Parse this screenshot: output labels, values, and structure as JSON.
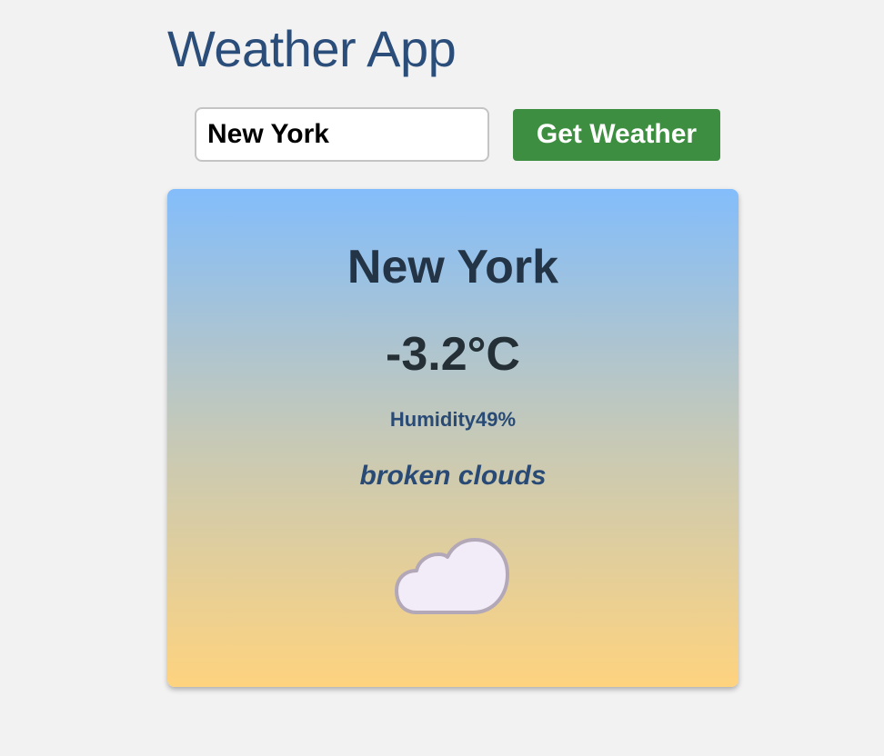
{
  "app": {
    "title": "Weather App"
  },
  "search": {
    "value": "New York",
    "button_label": "Get Weather"
  },
  "weather": {
    "city": "New York",
    "temperature": "-3.2°C",
    "humidity_label": "Humidity",
    "humidity_value": "49%",
    "description": "broken clouds",
    "icon": "cloud-icon"
  },
  "colors": {
    "background": "#f2f2f2",
    "title": "#2a4d7a",
    "button": "#3d8e41",
    "card_gradient_top": "#83bdfb",
    "card_gradient_bottom": "#fed37f",
    "cloud_fill": "#f2ecf8",
    "cloud_stroke": "#b3a8b8"
  }
}
